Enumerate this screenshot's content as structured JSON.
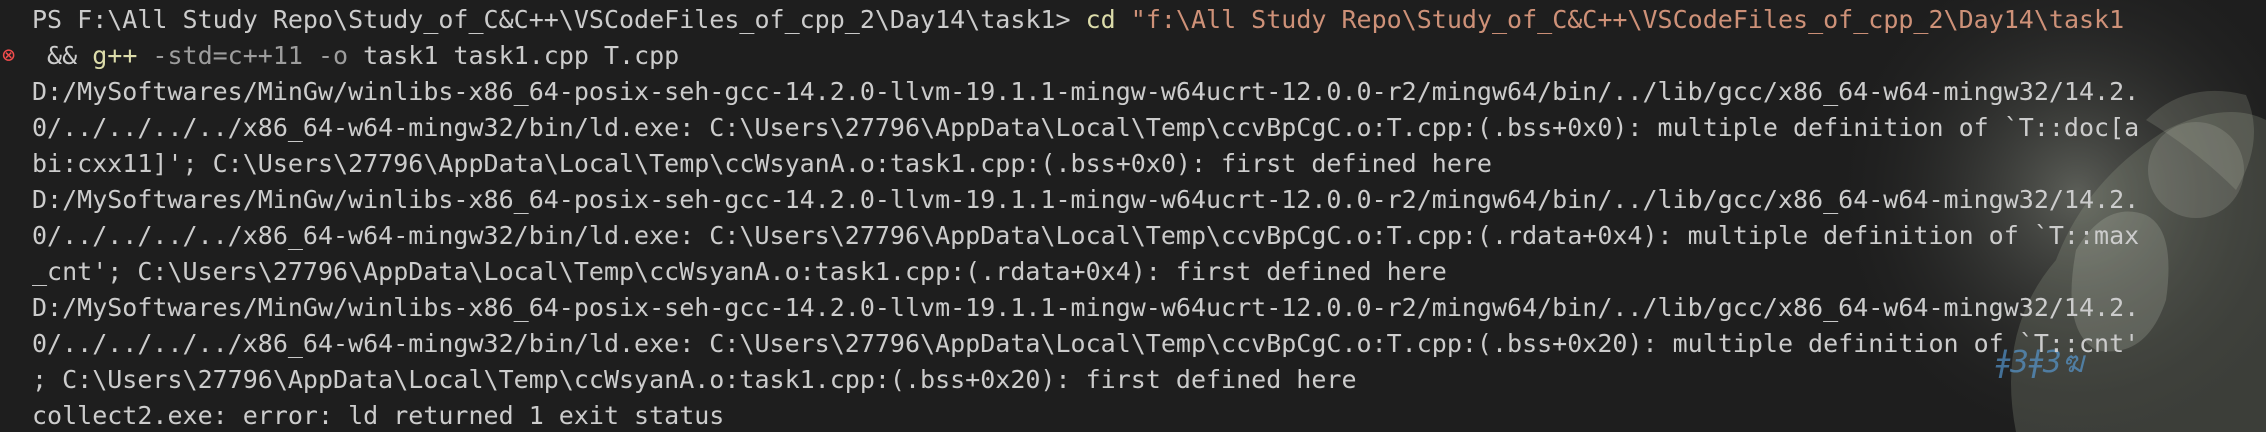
{
  "colors": {
    "background": "#1e1e1e",
    "text": "#cccccc",
    "command": "#dcdcaa",
    "string": "#ce9178",
    "option": "#9d9d9d",
    "error_icon": "#f14c4c"
  },
  "terminal": {
    "prompt": "PS F:\\All Study Repo\\Study_of_C&C++\\VSCodeFiles_of_cpp_2\\Day14\\task1> ",
    "cd_cmd": "cd",
    "cd_path": "\"f:\\All Study Repo\\Study_of_C&C++\\VSCodeFiles_of_cpp_2\\Day14\\task1",
    "error_icon": "error-icon",
    "error_icon_glyph": "⊗",
    "line2_and": " && ",
    "line2_cmd": "g++",
    "line2_opts": " -std=c++11 -o ",
    "line2_args": "task1 task1.cpp T.cpp",
    "output": [
      "D:/MySoftwares/MinGw/winlibs-x86_64-posix-seh-gcc-14.2.0-llvm-19.1.1-mingw-w64ucrt-12.0.0-r2/mingw64/bin/../lib/gcc/x86_64-w64-mingw32/14.2.",
      "0/../../../../x86_64-w64-mingw32/bin/ld.exe: C:\\Users\\27796\\AppData\\Local\\Temp\\ccvBpCgC.o:T.cpp:(.bss+0x0): multiple definition of `T::doc[a",
      "bi:cxx11]'; C:\\Users\\27796\\AppData\\Local\\Temp\\ccWsyanA.o:task1.cpp:(.bss+0x0): first defined here",
      "D:/MySoftwares/MinGw/winlibs-x86_64-posix-seh-gcc-14.2.0-llvm-19.1.1-mingw-w64ucrt-12.0.0-r2/mingw64/bin/../lib/gcc/x86_64-w64-mingw32/14.2.",
      "0/../../../../x86_64-w64-mingw32/bin/ld.exe: C:\\Users\\27796\\AppData\\Local\\Temp\\ccvBpCgC.o:T.cpp:(.rdata+0x4): multiple definition of `T::max",
      "_cnt'; C:\\Users\\27796\\AppData\\Local\\Temp\\ccWsyanA.o:task1.cpp:(.rdata+0x4): first defined here",
      "D:/MySoftwares/MinGw/winlibs-x86_64-posix-seh-gcc-14.2.0-llvm-19.1.1-mingw-w64ucrt-12.0.0-r2/mingw64/bin/../lib/gcc/x86_64-w64-mingw32/14.2.",
      "0/../../../../x86_64-w64-mingw32/bin/ld.exe: C:\\Users\\27796\\AppData\\Local\\Temp\\ccvBpCgC.o:T.cpp:(.bss+0x20): multiple definition of `T::cnt'",
      "; C:\\Users\\27796\\AppData\\Local\\Temp\\ccWsyanA.o:task1.cpp:(.bss+0x20): first defined here",
      "collect2.exe: error: ld returned 1 exit status"
    ]
  }
}
